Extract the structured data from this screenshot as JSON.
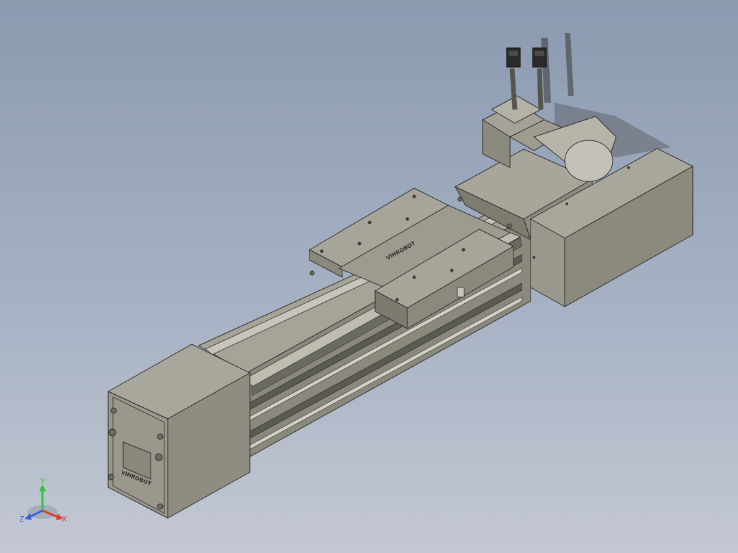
{
  "view": {
    "title": "",
    "background_top": "#8b9ab0",
    "background_bottom": "#c3c8d3"
  },
  "model": {
    "name": "",
    "carriage_logo_text": "VIHROBOT",
    "endcap_logo_text": "VIHROBOT",
    "body_color": "#8e8c80",
    "dark_color": "#4a4a46",
    "light_color": "#b8b6aa"
  },
  "triad": {
    "x_label": "X",
    "y_label": "Y",
    "z_label": "Z",
    "x_color": "#e23b2e",
    "y_color": "#2ec43a",
    "z_color": "#3a5fd6"
  }
}
